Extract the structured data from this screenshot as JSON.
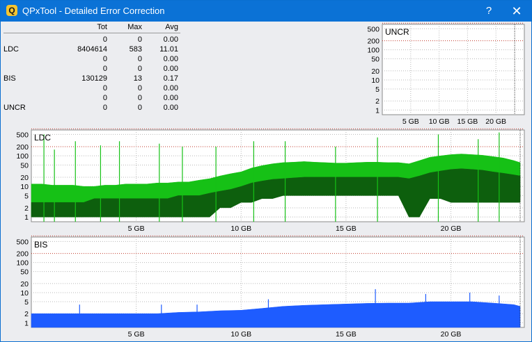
{
  "window": {
    "title": "QPxTool - Detailed Error Correction",
    "app_icon_letter": "Q",
    "help_label": "?",
    "close_label": "✕",
    "titlebar_color": "#0b72d6"
  },
  "stats": {
    "headers": {
      "tot": "Tot",
      "max": "Max",
      "avg": "Avg"
    },
    "rows": [
      {
        "label": "",
        "tot": "0",
        "max": "0",
        "avg": "0.00"
      },
      {
        "label": "LDC",
        "tot": "8404614",
        "max": "583",
        "avg": "11.01"
      },
      {
        "label": "",
        "tot": "0",
        "max": "0",
        "avg": "0.00"
      },
      {
        "label": "",
        "tot": "0",
        "max": "0",
        "avg": "0.00"
      },
      {
        "label": "BIS",
        "tot": "130129",
        "max": "13",
        "avg": "0.17"
      },
      {
        "label": "",
        "tot": "0",
        "max": "0",
        "avg": "0.00"
      },
      {
        "label": "",
        "tot": "0",
        "max": "0",
        "avg": "0.00"
      },
      {
        "label": "UNCR",
        "tot": "0",
        "max": "0",
        "avg": "0.00"
      }
    ]
  },
  "chart_data": [
    {
      "id": "uncr",
      "type": "area",
      "title": "UNCR",
      "scale": "log",
      "yticks": [
        "500",
        "200",
        "100",
        "50",
        "20",
        "10",
        "5",
        "2",
        "1"
      ],
      "ytick_values": [
        500,
        200,
        100,
        50,
        20,
        10,
        5,
        2,
        1
      ],
      "xticks": [
        "5 GB",
        "10 GB",
        "15 GB",
        "20 GB"
      ],
      "xtick_values": [
        5,
        10,
        15,
        20
      ],
      "xlim": [
        0,
        25
      ],
      "ylim": [
        0.7,
        700
      ],
      "end_marker_gb": 23.3,
      "grid": true,
      "threshold_color": "#c0392b",
      "series": [
        {
          "x": [
            0,
            23.3
          ],
          "values": [
            0,
            0
          ],
          "color": "#2ca02c"
        }
      ]
    },
    {
      "id": "ldc",
      "type": "area",
      "title": "LDC",
      "scale": "log",
      "yticks": [
        "500",
        "200",
        "100",
        "50",
        "20",
        "10",
        "5",
        "2",
        "1"
      ],
      "ytick_values": [
        500,
        200,
        100,
        50,
        20,
        10,
        5,
        2,
        1
      ],
      "xticks": [
        "5 GB",
        "10 GB",
        "15 GB",
        "20 GB"
      ],
      "xtick_values": [
        5,
        10,
        15,
        20
      ],
      "xlim": [
        0,
        23.5
      ],
      "ylim": [
        0.7,
        700
      ],
      "end_marker_gb": 23.3,
      "grid": true,
      "threshold_color": "#c0392b",
      "series": [
        {
          "color": "#16c116",
          "x": [
            0.0,
            0.5,
            1.0,
            1.5,
            2.0,
            2.5,
            3.0,
            3.5,
            4.0,
            4.5,
            5.0,
            5.5,
            6.0,
            6.5,
            7.0,
            7.5,
            8.0,
            8.5,
            9.0,
            9.5,
            10.0,
            10.5,
            11.0,
            11.5,
            12.0,
            12.5,
            13.0,
            13.5,
            14.0,
            14.5,
            15.0,
            15.5,
            16.0,
            16.5,
            17.0,
            17.5,
            18.0,
            18.5,
            19.0,
            19.5,
            20.0,
            20.5,
            21.0,
            21.5,
            22.0,
            22.5,
            23.0,
            23.3
          ],
          "values": [
            12,
            12,
            11,
            11,
            11,
            10,
            10,
            11,
            11,
            12,
            12,
            12,
            13,
            13,
            14,
            14,
            16,
            18,
            22,
            26,
            30,
            40,
            48,
            55,
            60,
            62,
            65,
            62,
            60,
            58,
            58,
            60,
            62,
            62,
            60,
            60,
            55,
            70,
            90,
            100,
            110,
            115,
            110,
            105,
            95,
            85,
            70,
            60
          ],
          "lows": [
            1,
            1,
            1,
            1,
            1,
            1,
            2,
            2,
            2,
            2,
            2,
            2,
            2,
            2,
            2,
            2,
            2,
            2,
            3,
            4,
            5,
            6,
            7,
            8,
            9,
            9,
            10,
            10,
            10,
            10,
            10,
            10,
            10,
            10,
            10,
            10,
            1,
            1,
            8,
            6,
            5,
            5,
            5,
            5,
            5,
            4,
            4,
            4
          ]
        },
        {
          "color": "#0d5f0d",
          "x": [
            0.0,
            0.5,
            1.0,
            1.5,
            2.0,
            2.5,
            3.0,
            3.5,
            4.0,
            4.5,
            5.0,
            5.5,
            6.0,
            6.5,
            7.0,
            7.5,
            8.0,
            8.5,
            9.0,
            9.5,
            10.0,
            10.5,
            11.0,
            11.5,
            12.0,
            12.5,
            13.0,
            13.5,
            14.0,
            14.5,
            15.0,
            15.5,
            16.0,
            16.5,
            17.0,
            17.5,
            18.0,
            18.5,
            19.0,
            19.5,
            20.0,
            20.5,
            21.0,
            21.5,
            22.0,
            22.5,
            23.0,
            23.3
          ],
          "values": [
            3,
            3,
            3,
            3,
            3,
            3,
            4,
            4,
            4,
            4,
            4,
            4,
            4,
            4,
            5,
            5,
            5,
            6,
            7,
            8,
            10,
            13,
            15,
            17,
            18,
            19,
            20,
            20,
            20,
            20,
            20,
            20,
            20,
            20,
            20,
            20,
            18,
            22,
            28,
            32,
            36,
            38,
            36,
            34,
            30,
            27,
            24,
            22
          ],
          "lows": [
            1,
            1,
            1,
            1,
            1,
            1,
            1,
            1,
            1,
            1,
            1,
            1,
            1,
            1,
            1,
            1,
            1,
            1,
            2,
            2,
            3,
            3,
            4,
            4,
            5,
            5,
            5,
            5,
            5,
            5,
            5,
            5,
            5,
            5,
            5,
            5,
            1,
            1,
            4,
            4,
            3,
            3,
            3,
            3,
            3,
            3,
            3,
            3
          ]
        }
      ],
      "spikes": [
        {
          "x": 0.6,
          "y": 500
        },
        {
          "x": 1.1,
          "y": 160
        },
        {
          "x": 2.1,
          "y": 300
        },
        {
          "x": 3.3,
          "y": 220
        },
        {
          "x": 4.2,
          "y": 300
        },
        {
          "x": 6.1,
          "y": 250
        },
        {
          "x": 7.2,
          "y": 200
        },
        {
          "x": 8.8,
          "y": 200
        },
        {
          "x": 10.6,
          "y": 300
        },
        {
          "x": 12.1,
          "y": 300
        },
        {
          "x": 14.5,
          "y": 200
        },
        {
          "x": 16.5,
          "y": 400
        },
        {
          "x": 19.4,
          "y": 500
        },
        {
          "x": 21.3,
          "y": 350
        },
        {
          "x": 22.3,
          "y": 583
        }
      ]
    },
    {
      "id": "bis",
      "type": "area",
      "title": "BIS",
      "scale": "log",
      "yticks": [
        "500",
        "200",
        "100",
        "50",
        "20",
        "10",
        "5",
        "2",
        "1"
      ],
      "ytick_values": [
        500,
        200,
        100,
        50,
        20,
        10,
        5,
        2,
        1
      ],
      "xticks": [
        "5 GB",
        "10 GB",
        "15 GB",
        "20 GB"
      ],
      "xtick_values": [
        5,
        10,
        15,
        20
      ],
      "xlim": [
        0,
        23.5
      ],
      "ylim": [
        0.7,
        700
      ],
      "end_marker_gb": 23.3,
      "grid": true,
      "threshold_color": "#c0392b",
      "series": [
        {
          "color": "#1e5cff",
          "x": [
            0.0,
            1.0,
            2.0,
            3.0,
            4.0,
            5.0,
            6.0,
            7.0,
            8.0,
            9.0,
            10.0,
            11.0,
            12.0,
            13.0,
            14.0,
            15.0,
            16.0,
            17.0,
            18.0,
            19.0,
            20.0,
            21.0,
            22.0,
            23.0,
            23.3
          ],
          "values": [
            2,
            2,
            2,
            2,
            2,
            2,
            2,
            2.2,
            2.3,
            2.5,
            2.6,
            3,
            3.5,
            3.8,
            4,
            4.2,
            4.4,
            4.5,
            4.5,
            5,
            5,
            5,
            4.5,
            4,
            3.5
          ],
          "lows": [
            0.7,
            0.7,
            0.7,
            0.7,
            0.7,
            0.7,
            0.7,
            0.7,
            0.7,
            0.7,
            0.7,
            0.7,
            0.7,
            0.7,
            0.7,
            0.7,
            0.7,
            0.7,
            0.7,
            0.7,
            0.7,
            0.7,
            0.7,
            0.7,
            0.7
          ]
        }
      ],
      "spikes": [
        {
          "x": 2.3,
          "y": 4
        },
        {
          "x": 6.2,
          "y": 4
        },
        {
          "x": 7.9,
          "y": 4
        },
        {
          "x": 11.3,
          "y": 6
        },
        {
          "x": 16.4,
          "y": 13
        },
        {
          "x": 18.8,
          "y": 9
        },
        {
          "x": 20.9,
          "y": 10
        },
        {
          "x": 22.3,
          "y": 8
        }
      ]
    }
  ]
}
